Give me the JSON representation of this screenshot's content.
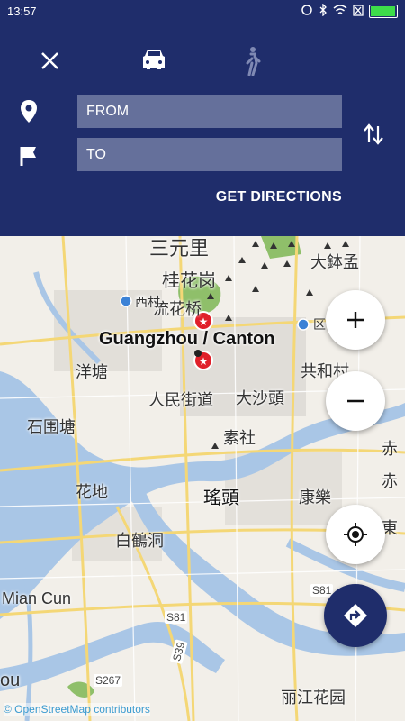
{
  "status_bar": {
    "time": "13:57"
  },
  "header": {
    "from_placeholder": "FROM",
    "to_placeholder": "TO",
    "get_directions_label": "GET DIRECTIONS"
  },
  "map": {
    "city_label": "Guangzhou / Canton",
    "place_labels": [
      "三元里",
      "桂花岗",
      "流花桥",
      "西村",
      "大鉢孟",
      "区",
      "洋塘",
      "人民街道",
      "大沙頭",
      "共和村",
      "石围塘",
      "素社",
      "赤",
      "赤",
      "花地",
      "瑤頭",
      "康樂",
      "東",
      "白鶴洞",
      "Mian Cun",
      "丽江花园",
      "ou"
    ],
    "road_labels": [
      "S81",
      "S81",
      "S39",
      "S267"
    ],
    "attribution": "© OpenStreetMap contributors"
  },
  "colors": {
    "header_bg": "#1f2d6b",
    "field_bg": "#65709b",
    "water": "#a9c6e6",
    "road_yellow": "#f4d776",
    "park_green": "#8fbf6a"
  },
  "icons": {
    "close": "close-icon",
    "car": "car-icon",
    "walk": "walk-icon",
    "from": "location-pin-icon",
    "to": "flag-icon",
    "swap": "swap-vertical-icon",
    "zoom_in": "plus-icon",
    "zoom_out": "minus-icon",
    "my_location": "crosshair-icon",
    "directions": "directions-icon"
  }
}
